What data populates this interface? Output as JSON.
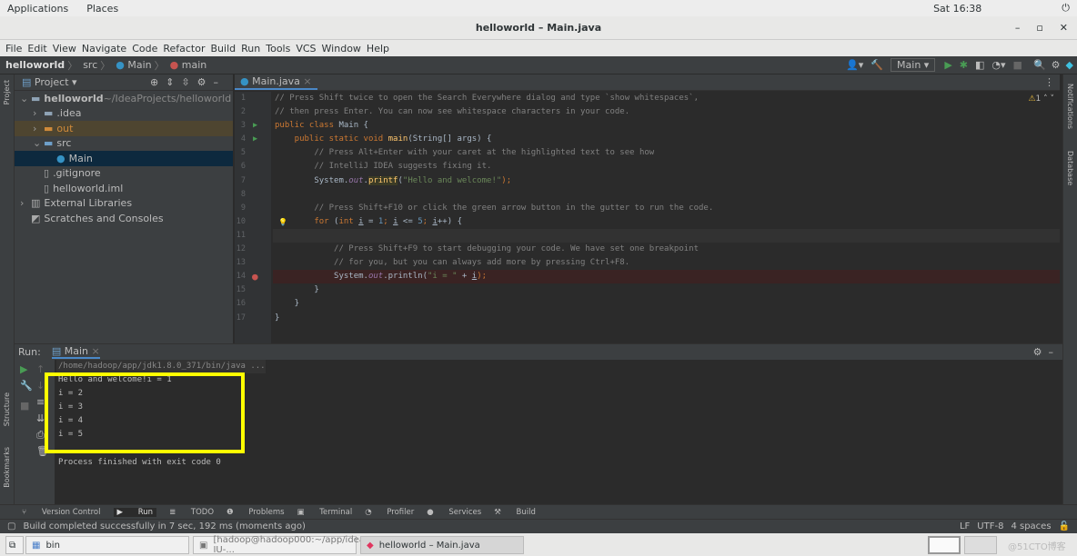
{
  "topbar": {
    "applications": "Applications",
    "places": "Places",
    "clock": "Sat 16:38"
  },
  "window": {
    "title": "helloworld – Main.java",
    "minimize": "–",
    "maximize": "▫",
    "close": "✕"
  },
  "menu": [
    "File",
    "Edit",
    "View",
    "Navigate",
    "Code",
    "Refactor",
    "Build",
    "Run",
    "Tools",
    "VCS",
    "Window",
    "Help"
  ],
  "breadcrumb": [
    "helloworld",
    "src",
    "Main",
    "main"
  ],
  "toolbar": {
    "run_config": "Main"
  },
  "project": {
    "title": "Project",
    "items": [
      {
        "label": "helloworld",
        "extra": "~/IdeaProjects/helloworld",
        "indent": 0,
        "type": "root"
      },
      {
        "label": ".idea",
        "indent": 1,
        "type": "folder"
      },
      {
        "label": "out",
        "indent": 1,
        "type": "out"
      },
      {
        "label": "src",
        "indent": 1,
        "type": "src"
      },
      {
        "label": "Main",
        "indent": 2,
        "type": "class"
      },
      {
        "label": ".gitignore",
        "indent": 1,
        "type": "file"
      },
      {
        "label": "helloworld.iml",
        "indent": 1,
        "type": "file"
      },
      {
        "label": "External Libraries",
        "indent": 0,
        "type": "lib"
      },
      {
        "label": "Scratches and Consoles",
        "indent": 0,
        "type": "scratch"
      }
    ]
  },
  "editor": {
    "tab": "Main.java",
    "warnings": "1",
    "lines": [
      [
        [
          "// Press Shift twice to open the Search Everywhere dialog and type `show whitespaces`,",
          "c"
        ]
      ],
      [
        [
          "// then press Enter. You can now see whitespace characters in your code.",
          "c"
        ]
      ],
      [
        [
          "public class ",
          "k"
        ],
        [
          "Main {",
          "p"
        ]
      ],
      [
        [
          "    public static void ",
          "k"
        ],
        [
          "main",
          "f"
        ],
        [
          "(String[] args) {",
          "p"
        ]
      ],
      [
        [
          "        // Press Alt+Enter with your caret at the highlighted text to see how",
          "c"
        ]
      ],
      [
        [
          "        // IntelliJ IDEA suggests fixing it.",
          "c"
        ]
      ],
      [
        [
          "        System.",
          "p"
        ],
        [
          "out",
          "o"
        ],
        [
          ".",
          "p"
        ],
        [
          "printf",
          "h"
        ],
        [
          "(",
          "p"
        ],
        [
          "\"Hello and welcome!\"",
          "s"
        ],
        [
          ");",
          "k"
        ]
      ],
      [],
      [
        [
          "        // Press Shift+F10 or click the green arrow button in the gutter to run the code.",
          "c"
        ]
      ],
      [
        [
          "        for ",
          "k"
        ],
        [
          "(",
          "p"
        ],
        [
          "int ",
          "k"
        ],
        [
          "i",
          "u"
        ],
        [
          " = ",
          "p"
        ],
        [
          "1",
          "n"
        ],
        [
          "; ",
          "k"
        ],
        [
          "i",
          "u"
        ],
        [
          " <= ",
          "p"
        ],
        [
          "5",
          "n"
        ],
        [
          "; ",
          "k"
        ],
        [
          "i",
          "u"
        ],
        [
          "++) {",
          "p"
        ]
      ],
      [],
      [
        [
          "            // Press Shift+F9 to start debugging your code. We have set one breakpoint",
          "c"
        ]
      ],
      [
        [
          "            // for you, but you can always add more by pressing Ctrl+F8.",
          "c"
        ]
      ],
      [
        [
          "            System.",
          "p"
        ],
        [
          "out",
          "o"
        ],
        [
          ".println(",
          "p"
        ],
        [
          "\"i = \"",
          "s"
        ],
        [
          " + ",
          "p"
        ],
        [
          "i",
          "u"
        ],
        [
          ");",
          "k"
        ]
      ],
      [
        [
          "        }",
          "p"
        ]
      ],
      [
        [
          "    }",
          "p"
        ]
      ],
      [
        [
          "}",
          "p"
        ]
      ]
    ]
  },
  "run": {
    "label": "Run:",
    "tab": "Main",
    "output": [
      "/home/hadoop/app/jdk1.8.0_371/bin/java ...",
      "Hello and welcome!i = 1",
      "i = 2",
      "i = 3",
      "i = 4",
      "i = 5",
      "",
      "Process finished with exit code 0"
    ],
    "highlight_color": "#ffff00"
  },
  "tooltabs": [
    "Version Control",
    "Run",
    "TODO",
    "Problems",
    "Terminal",
    "Profiler",
    "Services",
    "Build"
  ],
  "side": {
    "project": "Project",
    "structure": "Structure",
    "bookmarks": "Bookmarks",
    "notifications": "Notifications",
    "database": "Database"
  },
  "status": {
    "message": "Build completed successfully in 7 sec, 192 ms (moments ago)",
    "line_sep": "LF",
    "encoding": "UTF-8",
    "indent": "4 spaces"
  },
  "taskbar": [
    "bin",
    "[hadoop@hadoop000:~/app/idea-IU-...",
    "helloworld – Main.java"
  ],
  "watermark": "@51CTO博客"
}
